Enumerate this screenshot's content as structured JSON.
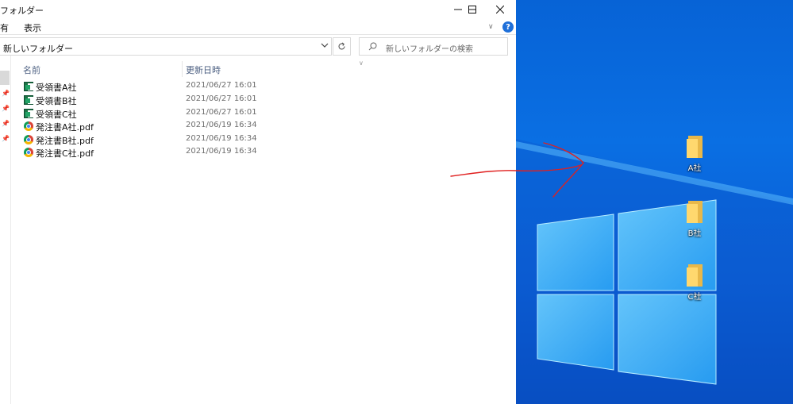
{
  "window": {
    "title": "フォルダー",
    "menu": [
      "有",
      "表示"
    ]
  },
  "address": {
    "path": "新しいフォルダー",
    "search_placeholder": "新しいフォルダーの検索"
  },
  "columns": {
    "name": "名前",
    "date": "更新日時"
  },
  "files": [
    {
      "name": "受領書A社",
      "date": "2021/06/27 16:01",
      "icon": "excel-icon"
    },
    {
      "name": "受領書B社",
      "date": "2021/06/27 16:01",
      "icon": "excel-icon"
    },
    {
      "name": "受領書C社",
      "date": "2021/06/27 16:01",
      "icon": "excel-icon"
    },
    {
      "name": "発注書A社.pdf",
      "date": "2021/06/19 16:34",
      "icon": "chrome-pdf-icon"
    },
    {
      "name": "発注書B社.pdf",
      "date": "2021/06/19 16:34",
      "icon": "chrome-pdf-icon"
    },
    {
      "name": "発注書C社.pdf",
      "date": "2021/06/19 16:34",
      "icon": "chrome-pdf-icon"
    }
  ],
  "desktop": {
    "folders": [
      "A社",
      "B社",
      "C社"
    ]
  },
  "colors": {
    "desktop_blue": "#0a6fe3",
    "annotation_red": "#e0201f",
    "folder_yellow": "#ffd86e"
  }
}
